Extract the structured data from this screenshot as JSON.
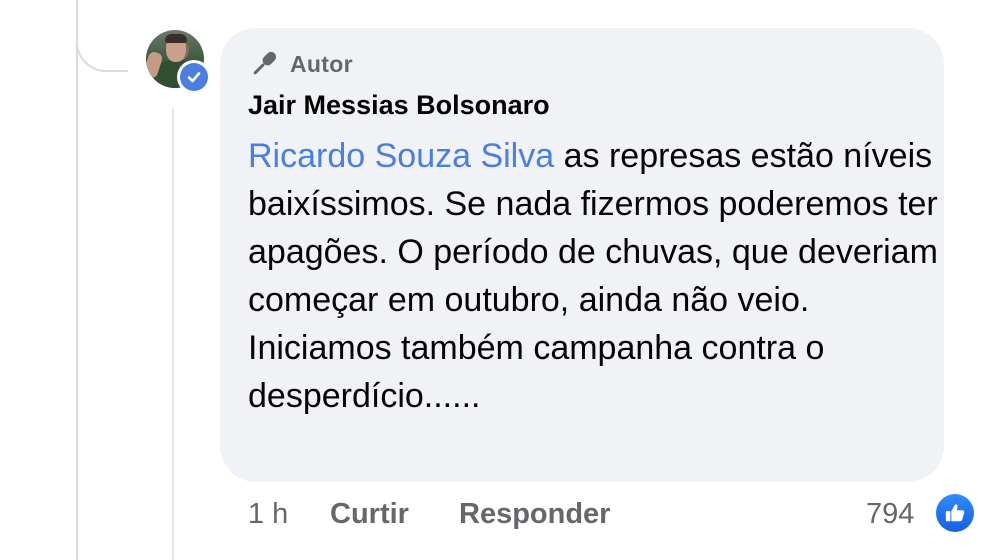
{
  "comment": {
    "badge": {
      "icon": "microphone-icon",
      "label": "Autor"
    },
    "author_name": "Jair Messias Bolsonaro",
    "mention": "Ricardo Souza Silva",
    "text": " as represas estão níveis baixíssimos. Se nada fizermos poderemos ter apagões. O período de chuvas, que deveriam começar em outubro, ainda não veio. Iniciamos também campanha contra o desperdício......",
    "verified_icon": "verified-check-icon"
  },
  "actions": {
    "time": "1 h",
    "like": "Curtir",
    "reply": "Responder"
  },
  "reactions": {
    "count": "794",
    "icon": "like-thumb-icon"
  },
  "colors": {
    "bubble": "#f0f2f5",
    "mention": "#4a7fe0",
    "like": "#1877f2",
    "meta_text": "#65676b"
  }
}
